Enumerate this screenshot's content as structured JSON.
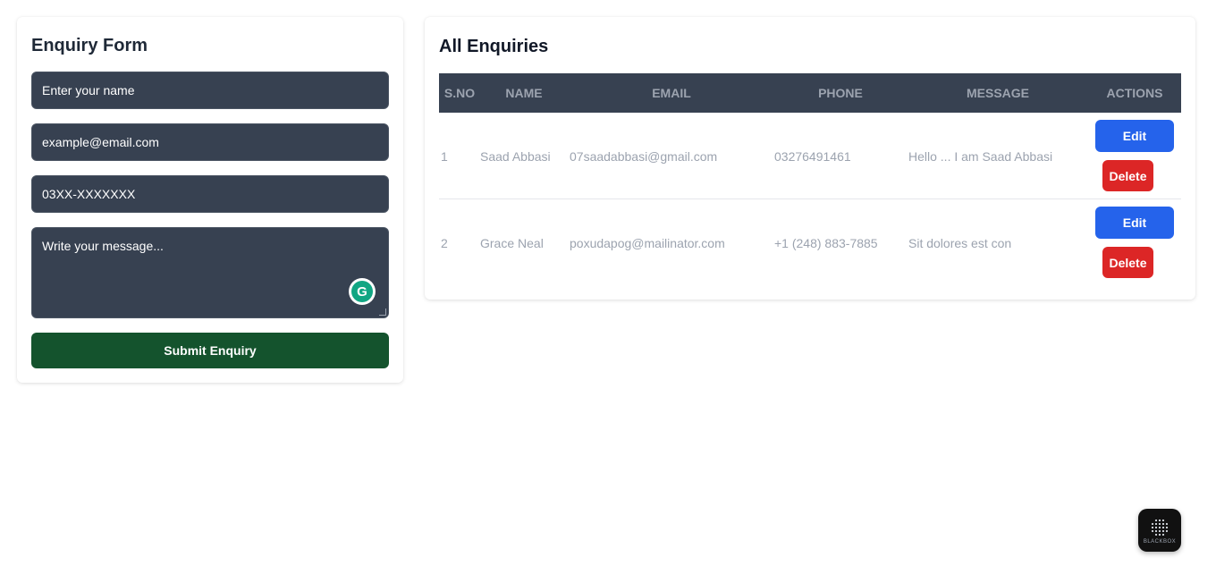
{
  "form": {
    "title": "Enquiry Form",
    "name_placeholder": "Enter your name",
    "email_placeholder": "example@email.com",
    "phone_placeholder": "03XX-XXXXXXX",
    "message_placeholder": "Write your message...",
    "submit_label": "Submit Enquiry"
  },
  "list": {
    "title": "All Enquiries",
    "columns": [
      "S.NO",
      "NAME",
      "EMAIL",
      "PHONE",
      "MESSAGE",
      "ACTIONS"
    ],
    "rows": [
      {
        "sno": "1",
        "name": "Saad Abbasi",
        "email": "07saadabbasi@gmail.com",
        "phone": "03276491461",
        "message": "Hello ... I am Saad Abbasi",
        "edit_label": "Edit",
        "delete_label": "Delete"
      },
      {
        "sno": "2",
        "name": "Grace Neal",
        "email": "poxudapog@mailinator.com",
        "phone": "+1 (248) 883-7885",
        "message": "Sit dolores est con",
        "edit_label": "Edit",
        "delete_label": "Delete"
      }
    ]
  },
  "extension": {
    "grammarly_icon": "grammarly-icon",
    "blackbox_label": "BLACKBOX"
  },
  "colors": {
    "field_bg": "#374151",
    "submit_bg": "#14532d",
    "edit_bg": "#2563eb",
    "delete_bg": "#dc2626",
    "table_header_bg": "#374151"
  }
}
